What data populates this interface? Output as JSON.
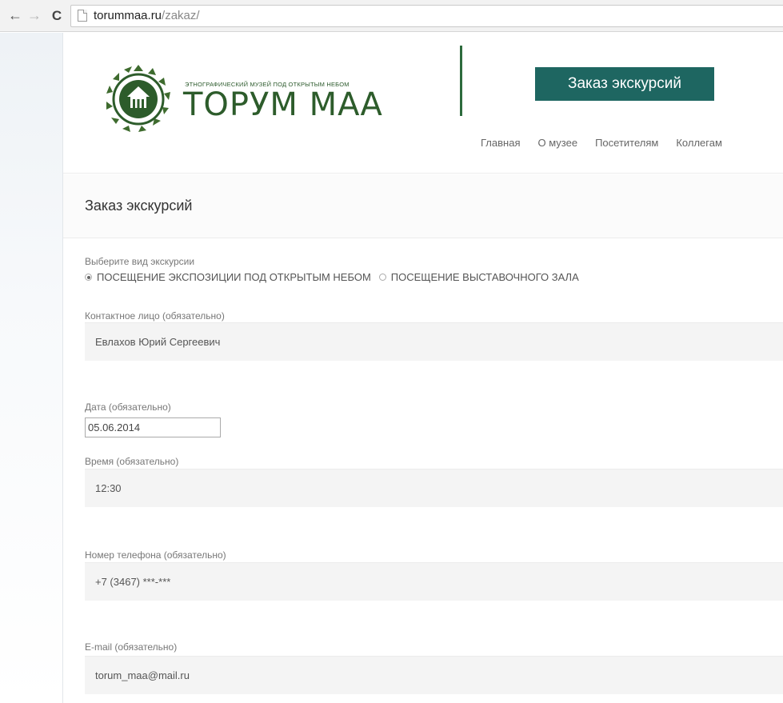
{
  "browser": {
    "url_host": "torummaa.ru",
    "url_path": "/zakaz/"
  },
  "header": {
    "logo_subtitle": "ЭТНОГРАФИЧЕСКИЙ МУЗЕЙ ПОД ОТКРЫТЫМ НЕБОМ",
    "logo_title": "ТОРУМ МАА",
    "order_button": "Заказ экскурсий",
    "nav": [
      "Главная",
      "О музее",
      "Посетителям",
      "Коллегам"
    ]
  },
  "page_title": "Заказ экскурсий",
  "form": {
    "tour_type_label": "Выберите вид экскурсии",
    "tour_options": [
      {
        "label": "ПОСЕЩЕНИЕ ЭКСПОЗИЦИИ ПОД ОТКРЫТЫМ НЕБОМ",
        "checked": true
      },
      {
        "label": "ПОСЕЩЕНИЕ ВЫСТАВОЧНОГО ЗАЛА",
        "checked": false
      }
    ],
    "contact_label": "Контактное лицо (обязательно)",
    "contact_value": "Евлахов Юрий Сергеевич",
    "date_label": "Дата (обязательно)",
    "date_value": "05.06.2014",
    "time_label": "Время (обязательно)",
    "time_value": "12:30",
    "phone_label": "Номер телефона (обязательно)",
    "phone_value": "+7 (3467) ***-***",
    "email_label": "E-mail (обязательно)",
    "email_value": "torum_maa@mail.ru"
  },
  "colors": {
    "brand_green": "#2d5c2b",
    "button_teal": "#1e6661"
  }
}
